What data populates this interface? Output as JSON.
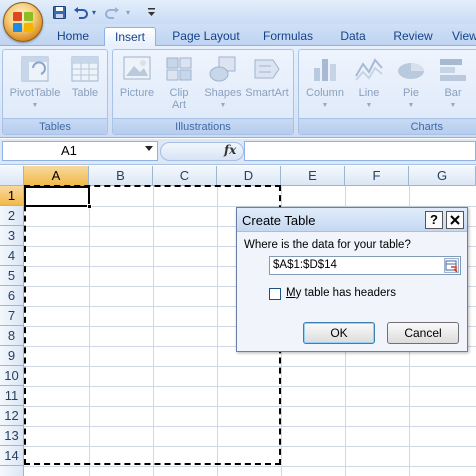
{
  "qat": {
    "save_icon": "save-icon",
    "undo_icon": "undo-icon",
    "redo_icon": "redo-icon",
    "customize_icon": "customize-qat-icon"
  },
  "tabs": [
    {
      "label": "Home",
      "active": false
    },
    {
      "label": "Insert",
      "active": true
    },
    {
      "label": "Page Layout",
      "active": false
    },
    {
      "label": "Formulas",
      "active": false
    },
    {
      "label": "Data",
      "active": false
    },
    {
      "label": "Review",
      "active": false
    },
    {
      "label": "View",
      "active": false
    }
  ],
  "ribbon": {
    "groups": [
      {
        "label": "Tables",
        "buttons": [
          "PivotTable",
          "Table"
        ]
      },
      {
        "label": "Illustrations",
        "buttons": [
          "Picture",
          "Clip Art",
          "Shapes",
          "SmartArt"
        ]
      },
      {
        "label": "Charts",
        "buttons": [
          "Column",
          "Line",
          "Pie",
          "Bar"
        ]
      }
    ],
    "clip_art_line1": "Clip",
    "clip_art_line2": "Art"
  },
  "formula_bar": {
    "name_box": "A1",
    "fx": "fx",
    "formula": ""
  },
  "grid": {
    "columns": [
      "A",
      "B",
      "C",
      "D",
      "E",
      "F",
      "G"
    ],
    "rows": [
      "1",
      "2",
      "3",
      "4",
      "5",
      "6",
      "7",
      "8",
      "9",
      "10",
      "11",
      "12",
      "13",
      "14"
    ],
    "selected_column": "A",
    "selected_row": "1"
  },
  "dialog": {
    "title": "Create Table",
    "help": "?",
    "close": "X",
    "question": "Where is the data for your table?",
    "range": "$A$1:$D$14",
    "checkbox_label_prefix": "",
    "checkbox_label_mnemonic": "M",
    "checkbox_label_rest": "y table has headers",
    "checkbox_checked": false,
    "ok": "OK",
    "cancel": "Cancel"
  }
}
